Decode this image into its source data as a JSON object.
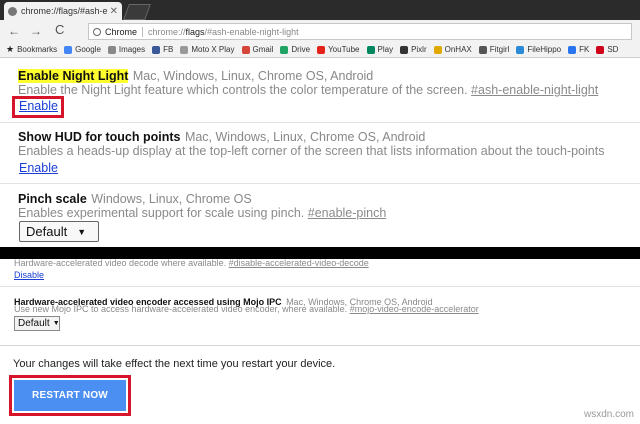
{
  "browser": {
    "tab_title": "chrome://flags/#ash-en",
    "tab_close": "✕",
    "back": "←",
    "forward": "→",
    "reload": "C",
    "omnibox_chip": "Chrome",
    "url_prefix": "chrome://",
    "url_bold": "flags",
    "url_suffix": "/#ash-enable-night-light"
  },
  "bookmarks": [
    {
      "label": "Bookmarks",
      "icon": "star-icon",
      "color": "#222222"
    },
    {
      "label": "Google",
      "icon": "google-icon",
      "color": "#4285f4"
    },
    {
      "label": "Images",
      "icon": "images-icon",
      "color": "#888888"
    },
    {
      "label": "FB",
      "icon": "facebook-icon",
      "color": "#3b5998"
    },
    {
      "label": "Moto X Play",
      "icon": "page-icon",
      "color": "#999999"
    },
    {
      "label": "Gmail",
      "icon": "gmail-icon",
      "color": "#d44638"
    },
    {
      "label": "Drive",
      "icon": "drive-icon",
      "color": "#1fa463"
    },
    {
      "label": "YouTube",
      "icon": "youtube-icon",
      "color": "#e62117"
    },
    {
      "label": "Play",
      "icon": "play-icon",
      "color": "#01875f"
    },
    {
      "label": "Pixlr",
      "icon": "pixlr-icon",
      "color": "#333333"
    },
    {
      "label": "OnHAX",
      "icon": "onhax-icon",
      "color": "#e0a800"
    },
    {
      "label": "Fitgirl",
      "icon": "fitgirl-icon",
      "color": "#555555"
    },
    {
      "label": "FileHippo",
      "icon": "filehippo-icon",
      "color": "#2b8ad8"
    },
    {
      "label": "FK",
      "icon": "fk-icon",
      "color": "#2874f0"
    },
    {
      "label": "SD",
      "icon": "sd-icon",
      "color": "#d0021b"
    }
  ],
  "flags": {
    "night_light": {
      "title": "Enable Night Light",
      "platforms": "Mac, Windows, Linux, Chrome OS, Android",
      "description": "Enable the Night Light feature which controls the color temperature of the screen.",
      "anchor": "#ash-enable-night-light",
      "action": "Enable"
    },
    "hud": {
      "title": "Show HUD for touch points",
      "platforms": "Mac, Windows, Linux, Chrome OS, Android",
      "description": "Enables a heads-up display at the top-left corner of the screen that lists information about the touch-points",
      "action": "Enable"
    },
    "pinch": {
      "title": "Pinch scale",
      "platforms": "Windows, Linux, Chrome OS",
      "description": "Enables experimental support for scale using pinch.",
      "anchor": "#enable-pinch",
      "select_value": "Default",
      "select_arrow": "▼"
    },
    "video_decode": {
      "description": "Hardware-accelerated video decode where available.",
      "anchor": "#disable-accelerated-video-decode",
      "action": "Disable"
    },
    "video_encode": {
      "title": "Hardware-accelerated video encoder accessed using Mojo IPC",
      "platforms": "Mac, Windows, Chrome OS, Android",
      "description": "Use new Mojo IPC to access hardware-accelerated video encoder, where available.",
      "anchor": "#mojo-video-encode-accelerator",
      "select_value": "Default",
      "select_arrow": "▼"
    }
  },
  "footer": {
    "notice": "Your changes will take effect the next time you restart your device.",
    "restart_label": "RESTART NOW"
  },
  "watermark": "wsxdn.com",
  "colors": {
    "highlight": "#ffff2e",
    "annotation_red": "#d6142a",
    "link_blue": "#1a3fd6",
    "restart_blue": "#4b8ff2"
  }
}
